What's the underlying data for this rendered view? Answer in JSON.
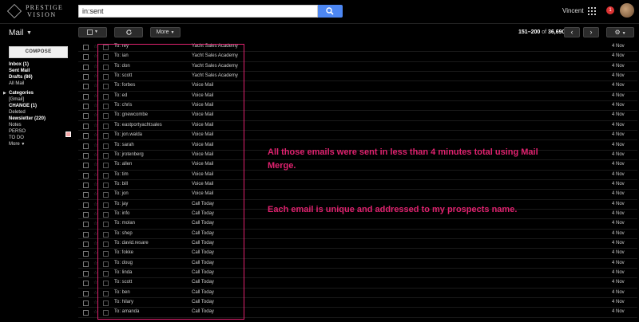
{
  "brand": {
    "line1": "PRESTIGE",
    "line2": "VISION"
  },
  "search": {
    "value": "in:sent"
  },
  "header": {
    "user_name": "Vincent",
    "notification_count": "1"
  },
  "app": {
    "title": "Mail"
  },
  "toolbar": {
    "more_label": "More",
    "range": "151–200",
    "of_label": "of",
    "total": "36,690"
  },
  "sidebar": {
    "compose_label": "COMPOSE",
    "items": [
      {
        "label": "Inbox (1)",
        "bold": true
      },
      {
        "label": "Sent Mail",
        "bold": true
      },
      {
        "label": "Drafts (86)",
        "bold": true
      },
      {
        "label": "All Mail",
        "bold": false
      },
      {
        "label": "Categories",
        "bold": true
      },
      {
        "label": "[Gmail]",
        "bold": false
      },
      {
        "label": "CHANGE (1)",
        "bold": true
      },
      {
        "label": "Deleted",
        "bold": false
      },
      {
        "label": "Newsletter (220)",
        "bold": true
      },
      {
        "label": "Notes",
        "bold": false
      },
      {
        "label": "PERSO",
        "bold": false
      },
      {
        "label": "TO DO",
        "bold": false
      },
      {
        "label": "More",
        "bold": false
      }
    ]
  },
  "emails": [
    {
      "to": "To: rey",
      "subject": "Yacht Sales Academy",
      "date": "4 Nov"
    },
    {
      "to": "To: ian",
      "subject": "Yacht Sales Academy",
      "date": "4 Nov"
    },
    {
      "to": "To: don",
      "subject": "Yacht Sales Academy",
      "date": "4 Nov"
    },
    {
      "to": "To: scott",
      "subject": "Yacht Sales Academy",
      "date": "4 Nov"
    },
    {
      "to": "To: forbes",
      "subject": "Voice Mail",
      "date": "4 Nov"
    },
    {
      "to": "To: ed",
      "subject": "Voice Mail",
      "date": "4 Nov"
    },
    {
      "to": "To: chris",
      "subject": "Voice Mail",
      "date": "4 Nov"
    },
    {
      "to": "To: gnewcombe",
      "subject": "Voice Mail",
      "date": "4 Nov"
    },
    {
      "to": "To: eastportyachtsales",
      "subject": "Voice Mail",
      "date": "4 Nov"
    },
    {
      "to": "To: jon.walda",
      "subject": "Voice Mail",
      "date": "4 Nov"
    },
    {
      "to": "To: sarah",
      "subject": "Voice Mail",
      "date": "4 Nov"
    },
    {
      "to": "To: jrotenberg",
      "subject": "Voice Mail",
      "date": "4 Nov"
    },
    {
      "to": "To: allen",
      "subject": "Voice Mail",
      "date": "4 Nov"
    },
    {
      "to": "To: tim",
      "subject": "Voice Mail",
      "date": "4 Nov"
    },
    {
      "to": "To: bill",
      "subject": "Voice Mail",
      "date": "4 Nov"
    },
    {
      "to": "To: jon",
      "subject": "Voice Mail",
      "date": "4 Nov"
    },
    {
      "to": "To: jay",
      "subject": "Call Today",
      "date": "4 Nov"
    },
    {
      "to": "To: info",
      "subject": "Call Today",
      "date": "4 Nov"
    },
    {
      "to": "To: molan",
      "subject": "Call Today",
      "date": "4 Nov"
    },
    {
      "to": "To: shep",
      "subject": "Call Today",
      "date": "4 Nov"
    },
    {
      "to": "To: david.resare",
      "subject": "Call Today",
      "date": "4 Nov"
    },
    {
      "to": "To: fokke",
      "subject": "Call Today",
      "date": "4 Nov"
    },
    {
      "to": "To: doug",
      "subject": "Call Today",
      "date": "4 Nov"
    },
    {
      "to": "To: linda",
      "subject": "Call Today",
      "date": "4 Nov"
    },
    {
      "to": "To: scott",
      "subject": "Call Today",
      "date": "4 Nov"
    },
    {
      "to": "To: ben",
      "subject": "Call Today",
      "date": "4 Nov"
    },
    {
      "to": "To: hilary",
      "subject": "Call Today",
      "date": "4 Nov"
    },
    {
      "to": "To: amanda",
      "subject": "Call Today",
      "date": "4 Nov"
    }
  ],
  "annotations": {
    "first_line1": "All those emails were sent in less than 4 minutes total using Mail",
    "first_line2": "Merge.",
    "second": "Each email is unique and addressed to my prospects name."
  },
  "colors": {
    "annotation": "#e0226f",
    "search_button": "#4d87f3",
    "notification": "#dd3333"
  }
}
